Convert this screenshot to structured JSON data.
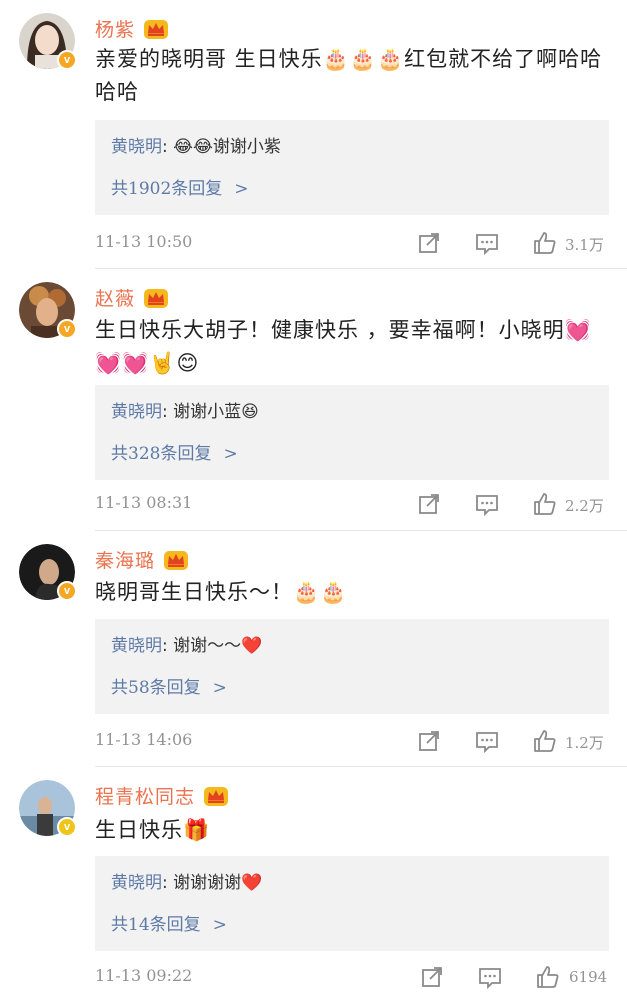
{
  "comments": [
    {
      "name": "杨紫",
      "text": "亲爱的晓明哥 生日快乐🎂🎂🎂红包就不给了啊哈哈哈哈",
      "reply_author": "黄晓明",
      "reply_text": "😂😂谢谢小紫",
      "more": "共1902条回复",
      "time": "11-13 10:50",
      "likes": "3.1万"
    },
    {
      "name": "赵薇",
      "text": "生日快乐大胡子！健康快乐 ，要幸福啊！小晓明💓💓💓🤘😊",
      "reply_author": "黄晓明",
      "reply_text": "谢谢小蓝😆",
      "more": "共328条回复",
      "time": "11-13 08:31",
      "likes": "2.2万"
    },
    {
      "name": "秦海璐",
      "text": "晓明哥生日快乐～！🎂🎂",
      "reply_author": "黄晓明",
      "reply_text": "谢谢～～❤️",
      "more": "共58条回复",
      "time": "11-13 14:06",
      "likes": "1.2万"
    },
    {
      "name": "程青松同志",
      "text": "生日快乐🎁",
      "reply_author": "黄晓明",
      "reply_text": "谢谢谢谢❤️",
      "more": "共14条回复",
      "time": "11-13 09:22",
      "likes": "6194"
    }
  ],
  "colors": {
    "name": "#eb7350",
    "link": "#5d7aa7",
    "meta": "#939393",
    "reply_bg": "#f2f2f2",
    "badge": "#f5a623"
  },
  "icons": [
    "crown-icon",
    "verified-badge-icon",
    "forward-icon",
    "comment-icon",
    "like-icon",
    "chevron-right-icon"
  ]
}
